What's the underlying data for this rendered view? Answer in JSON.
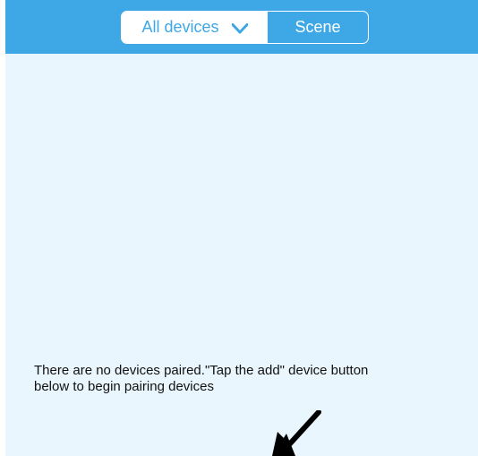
{
  "header": {
    "segments": {
      "left_label": "All devices",
      "right_label": "Scene"
    }
  },
  "main": {
    "empty_message_line1": "There are no devices paired.\"Tap the add\" device button",
    "empty_message_line2": "below to begin pairing devices"
  },
  "icons": {
    "dropdown": "chevron-down-icon",
    "pointer": "arrow-down-left-icon"
  },
  "colors": {
    "header": "#3ea8e6",
    "background": "#eaf6fd",
    "text": "#111111"
  }
}
